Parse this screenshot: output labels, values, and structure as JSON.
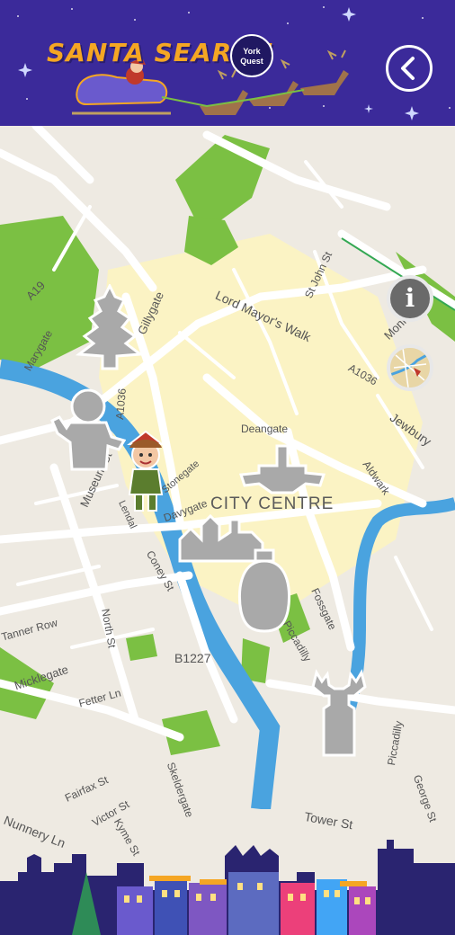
{
  "header": {
    "title": "SANTA SEARCH",
    "logo_line1": "York",
    "logo_line2": "Quest",
    "back_icon": "chevron-left-icon"
  },
  "map": {
    "city_label": "CITY CENTRE",
    "streets": [
      "Lord Mayor's Walk",
      "St John St",
      "Monkgate",
      "A19",
      "Gillygate",
      "Marygate",
      "A1036",
      "Jewbury",
      "Deangate",
      "Museum St",
      "Aldwark",
      "Lendal",
      "Stonegate",
      "Davygate",
      "Coney St",
      "North St",
      "Fossgate",
      "Piccadilly",
      "B1227",
      "Micklegate",
      "Fetter Ln",
      "Fairfax St",
      "Skeldergate",
      "Victor St",
      "Kyme St",
      "Nunnery Ln",
      "Tower St",
      "George St",
      "Tanner Row"
    ],
    "markers": [
      "tree-marker",
      "elf-marker",
      "character-marker",
      "elf-character",
      "minster-marker",
      "shambles-marker",
      "bauble-marker",
      "reindeer-marker"
    ]
  },
  "controls": {
    "info_label": "i",
    "info_icon": "info-icon",
    "map_thumb_icon": "map-thumbnail-icon"
  },
  "colors": {
    "header_bg": "#3b2a9a",
    "title": "#f5a623",
    "river": "#4aa3df",
    "park": "#7bc043",
    "city_area": "#fbf3c4",
    "marker": "#a9a9a9"
  }
}
